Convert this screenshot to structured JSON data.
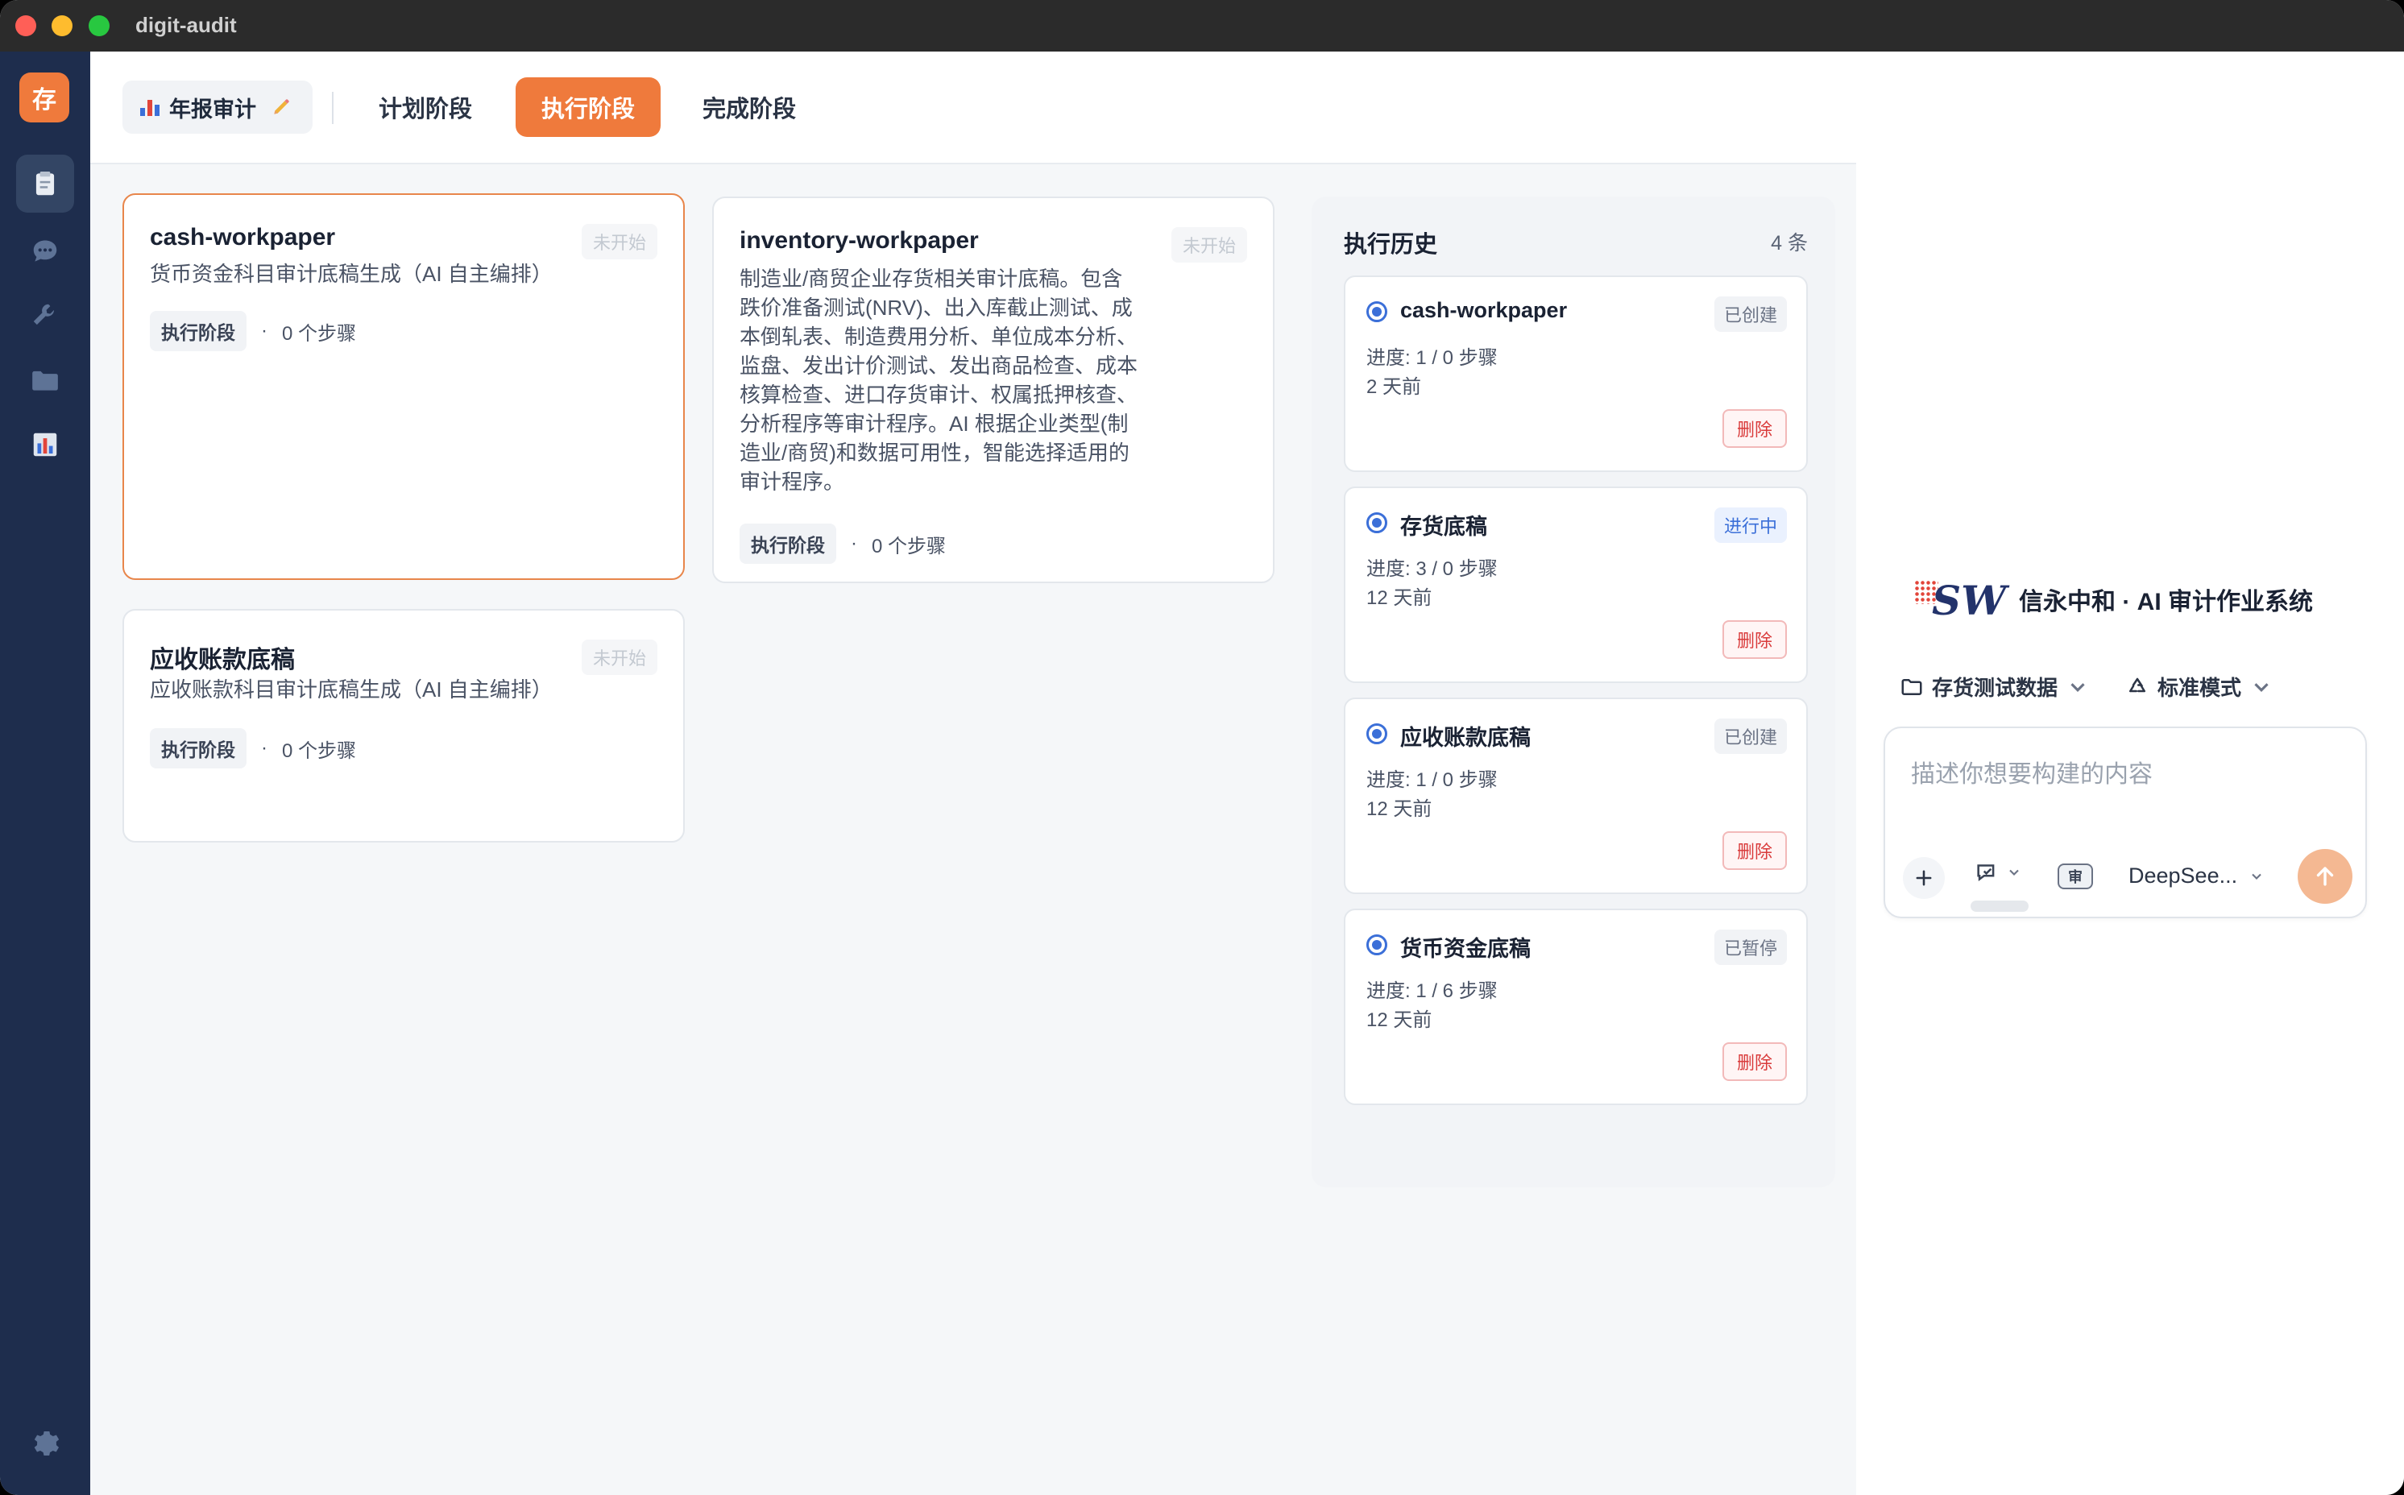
{
  "window": {
    "title": "digit-audit"
  },
  "rail": {
    "logo_text": "存",
    "items": [
      {
        "icon": "clipboard-icon"
      },
      {
        "icon": "chat-icon"
      },
      {
        "icon": "wrench-icon"
      },
      {
        "icon": "folder-icon"
      },
      {
        "icon": "bar-chart-icon"
      }
    ],
    "settings_icon": "gear-icon"
  },
  "topbar": {
    "project_label": "年报审计",
    "stages": [
      "计划阶段",
      "执行阶段",
      "完成阶段"
    ],
    "active_stage": "执行阶段"
  },
  "cards": [
    {
      "title": "cash-workpaper",
      "status": "未开始",
      "description": "货币资金科目审计底稿生成（AI 自主编排）",
      "tag": "执行阶段",
      "steps": "0 个步骤"
    },
    {
      "title": "inventory-workpaper",
      "status": "未开始",
      "description_lines": [
        "制造业/商贸企业存货相关审计底稿。包含",
        "跌价准备测试(NRV)、出入库截止测试、成",
        "本倒轧表、制造费用分析、单位成本分析、",
        "监盘、发出计价测试、发出商品检查、成本",
        "核算检查、进口存货审计、权属抵押核查、",
        "分析程序等审计程序。AI 根据企业类型(制",
        "造业/商贸)和数据可用性，智能选择适用的",
        "审计程序。"
      ],
      "tag": "执行阶段",
      "steps": "0 个步骤"
    },
    {
      "title": "应收账款底稿",
      "status": "未开始",
      "description": "应收账款科目审计底稿生成（AI 自主编排）",
      "tag": "执行阶段",
      "steps": "0 个步骤"
    }
  ],
  "history": {
    "title": "执行历史",
    "count": "4 条",
    "items": [
      {
        "name": "cash-workpaper",
        "badge": "已创建",
        "progress": "进度: 1 / 0 步骤",
        "time": "2 天前",
        "delete": "删除"
      },
      {
        "name": "存货底稿",
        "badge": "进行中",
        "progress": "进度: 3 / 0 步骤",
        "time": "12 天前",
        "delete": "删除"
      },
      {
        "name": "应收账款底稿",
        "badge": "已创建",
        "progress": "进度: 1 / 0 步骤",
        "time": "12 天前",
        "delete": "删除"
      },
      {
        "name": "货币资金底稿",
        "badge": "已暂停",
        "progress": "进度: 1 / 6 步骤",
        "time": "12 天前",
        "delete": "删除"
      }
    ]
  },
  "assistant": {
    "brand_logo_text": "SW",
    "brand_name": "信永中和 · AI 审计作业系统",
    "data_selector": "存货测试数据",
    "mode_selector": "标准模式",
    "input_placeholder": "描述你想要构建的内容",
    "audit_badge": "审",
    "model": "DeepSee..."
  },
  "colors": {
    "accent": "#ef7a3c",
    "rail_bg": "#1e2d4d",
    "link_blue": "#3b6fd8",
    "danger": "#d93b3b"
  }
}
